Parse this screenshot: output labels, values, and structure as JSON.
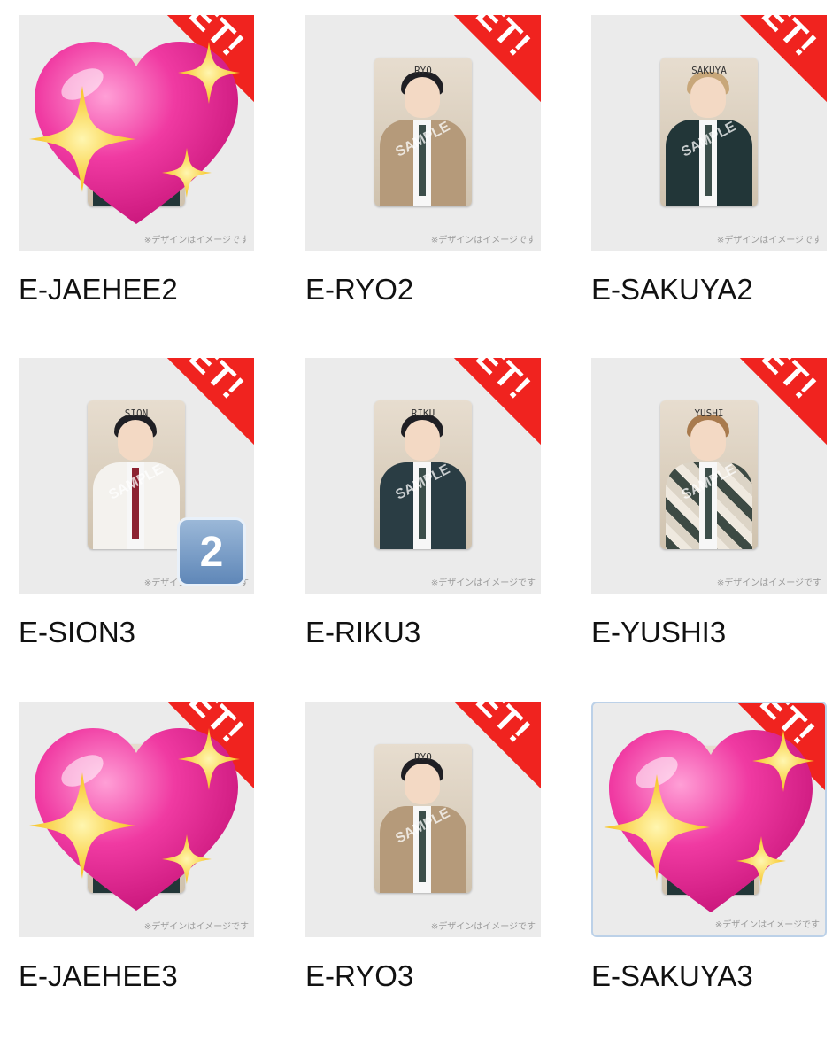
{
  "ribbon_text": "GET!",
  "disclaimer": "※デザインはイメージです",
  "badge_value": "2",
  "cards": [
    {
      "label": "E-JAEHEE2",
      "tag": "",
      "covered": true
    },
    {
      "label": "E-RYO2",
      "tag": "RYO",
      "covered": false
    },
    {
      "label": "E-SAKUYA2",
      "tag": "SAKUYA",
      "covered": false
    },
    {
      "label": "E-SION3",
      "tag": "SION",
      "covered": false,
      "badge": true
    },
    {
      "label": "E-RIKU3",
      "tag": "RIKU",
      "covered": false
    },
    {
      "label": "E-YUSHI3",
      "tag": "YUSHI",
      "covered": false
    },
    {
      "label": "E-JAEHEE3",
      "tag": "",
      "covered": true
    },
    {
      "label": "E-RYO3",
      "tag": "RYO",
      "covered": false
    },
    {
      "label": "E-SAKUYA3",
      "tag": "",
      "covered": true,
      "selected": true
    }
  ],
  "watermark": "SAMPLE",
  "icons": {
    "heart": "sparkling-heart-icon",
    "badge": "keycap-2-icon"
  },
  "colors": {
    "ribbon": "#f0231f",
    "heart": "#e8319b"
  }
}
